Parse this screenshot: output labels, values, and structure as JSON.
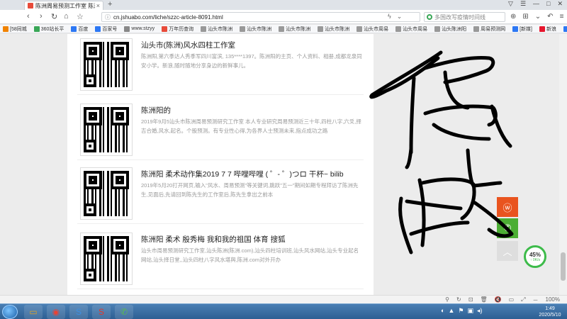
{
  "browser": {
    "tab_title": "陈洲周易预测工作室 陈洲阳-汕头",
    "tab_close": "×",
    "new_tab": "+",
    "window_controls": [
      "▽",
      "☰",
      "—",
      "□",
      "✕"
    ],
    "nav": {
      "back": "‹",
      "forward": "›",
      "home": "⌂",
      "refresh": "↻",
      "favorite": "☆"
    },
    "url": "cn.jshuabo.com/liche/szzc-article-8091.html",
    "search_placeholder": "多国改写疫情时间线",
    "bookmarks": [
      {
        "label": "[58同城",
        "color": "#f08300"
      },
      {
        "label": "360站长平",
        "color": "#3aa757"
      },
      {
        "label": "百度",
        "color": "#2d78f4"
      },
      {
        "label": "百家号",
        "color": "#2d78f4"
      },
      {
        "label": "www.stzyy",
        "color": "#888888"
      },
      {
        "label": "万年历查询",
        "color": "#e84b3a"
      },
      {
        "label": "汕头市陈洲",
        "color": "#999999"
      },
      {
        "label": "汕头市陈洲",
        "color": "#999999"
      },
      {
        "label": "汕头市陈洲",
        "color": "#999999"
      },
      {
        "label": "汕头市陈洲",
        "color": "#999999"
      },
      {
        "label": "汕头市周易",
        "color": "#999999"
      },
      {
        "label": "汕头市周易",
        "color": "#999999"
      },
      {
        "label": "汕头陈洲阳",
        "color": "#999999"
      },
      {
        "label": "周易预测网",
        "color": "#999999"
      },
      {
        "label": "[新媒]",
        "color": "#2d78f4"
      },
      {
        "label": "新浪",
        "color": "#e6162d"
      },
      {
        "label": "百度搜索",
        "color": "#2d78f4"
      }
    ]
  },
  "articles": [
    {
      "title": "汕头市(陈洲)风水四柱工作室",
      "desc": "陈洲阳,第六季达人秀季军四川富滨, 135****1397。陈洲阳的主页、个人资料、相册,成都龙泉同安小学。新浪,随时随地分享身边的新鲜事儿。"
    },
    {
      "title": "陈洲阳的",
      "desc": "2019年9月5汕头市陈洲周易预测研究工作室 本人专业研究周易预测近三十年,四柱八字,六爻,择吉合婚,风水,起名。个股预测。有专业性心得,为各界人士预测未来,指点成功之路"
    },
    {
      "title": "陈洲阳 柔术动作集2019 7 7 哔哩哔哩 ( ゜- ゜)つロ 干杯~ bilib",
      "desc": "2019年5月20打开网页,输入\"风水、周易预测\"等关键词,跳跃\"五一\"期间如期专程拜访了陈洲先生,见面后,先请回到陈先生的工作室后,陈先生拿出之前本"
    },
    {
      "title": "陈洲阳 柔术 殷秀梅 我和我的祖国 体育 搜狐",
      "desc": "汕头市周易预测研究工作室,汕头陈洲(陈洲.com),汕头四柱培训班,汕头风水网站,汕头专业起名网站,汕头择日堂,,汕头四柱八字风水堪舆,陈洲.com对外开办"
    }
  ],
  "side_buttons": {
    "weibo": "ⓦ",
    "wechat": "✆",
    "top": "︿"
  },
  "net_widget": {
    "percent": "45%",
    "speed": "↑ 0K/s"
  },
  "status_icons": [
    "⚲",
    "↻",
    "⊡",
    "🗑",
    "🔇",
    "▭",
    "⤢",
    "－",
    "100%"
  ],
  "taskbar": {
    "tasks": [
      {
        "name": "explorer",
        "icon": "▭",
        "color": "#d9a227"
      },
      {
        "name": "chrome",
        "icon": "◉",
        "color": "#e94235"
      },
      {
        "name": "sogou",
        "icon": "S",
        "color": "#3d8fe0"
      },
      {
        "name": "sogou-ime",
        "icon": "S",
        "color": "#e2382b"
      },
      {
        "name": "wechat",
        "icon": "✆",
        "color": "#5bbd4b"
      }
    ],
    "tray": [
      "◐",
      "▲",
      "⚑",
      "▣",
      "◂)"
    ],
    "time": "1:49",
    "date": "2020/5/10"
  },
  "handwriting_color": "#000000"
}
